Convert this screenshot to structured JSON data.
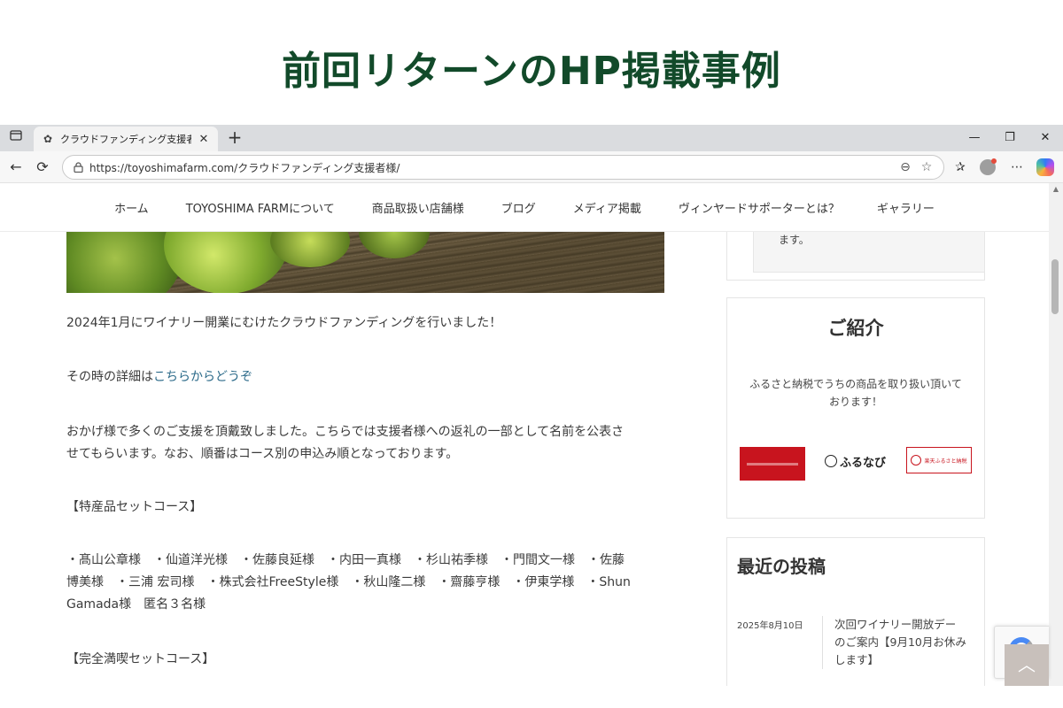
{
  "slide": {
    "title": "前回リターンのHP掲載事例"
  },
  "browser": {
    "tab": {
      "title": "クラウドファンディング支援者様 | TOYOSHIMA FARM"
    },
    "url": "https://toyoshimafarm.com/クラウドファンディング支援者様/"
  },
  "site": {
    "nav": [
      "ホーム",
      "TOYOSHIMA FARMについて",
      "商品取扱い店舗様",
      "ブログ",
      "メディア掲載",
      "ヴィンヤードサポーターとは？",
      "ギャラリー"
    ]
  },
  "article": {
    "p1": "2024年1月にワイナリー開業にむけたクラウドファンディングを行いました！",
    "p2_prefix": "その時の詳細は",
    "p2_link": "こちらからどうぞ",
    "p3_line1": "おかげ様で多くのご支援を頂戴致しました。こちらでは支援者様への返礼の一部として名前を公表さ",
    "p3_line2": "せてもらいます。なお、順番はコース別の申込み順となっております。",
    "course1_heading": "【特産品セットコース】",
    "course1_line1": "・髙山公章様　・仙道洋光様　・佐藤良延様　・内田一真様　・杉山祐季様　・門間文一様　・佐藤",
    "course1_line2": "博美様　・三浦 宏司様　・株式会社FreeStyle様　・秋山隆二様　・齋藤亨様　・伊東学様　・Shun",
    "course1_line3": "Gamada様　匿名３名様",
    "course2_heading": "【完全満喫セットコース】"
  },
  "sidebar": {
    "top_card_text": "ます。",
    "intro": {
      "heading": "ご紹介",
      "text_line1": "ふるさと納税でうちの商品を取り扱い頂いて",
      "text_line2": "おります！",
      "logo_furunavi": "ふるなび",
      "logo_rakuten": "楽天ふるさと納税"
    },
    "recent": {
      "heading": "最近の投稿",
      "posts": [
        {
          "date": "2025年8月10日",
          "title_line1": "次回ワイナリー開放デー",
          "title_line2": "のご案内【9月10月お休み",
          "title_line3": "します】"
        }
      ]
    }
  },
  "colors": {
    "title_green": "#124a2a",
    "link": "#2d6b8a",
    "card_border": "#e5e5e5"
  }
}
